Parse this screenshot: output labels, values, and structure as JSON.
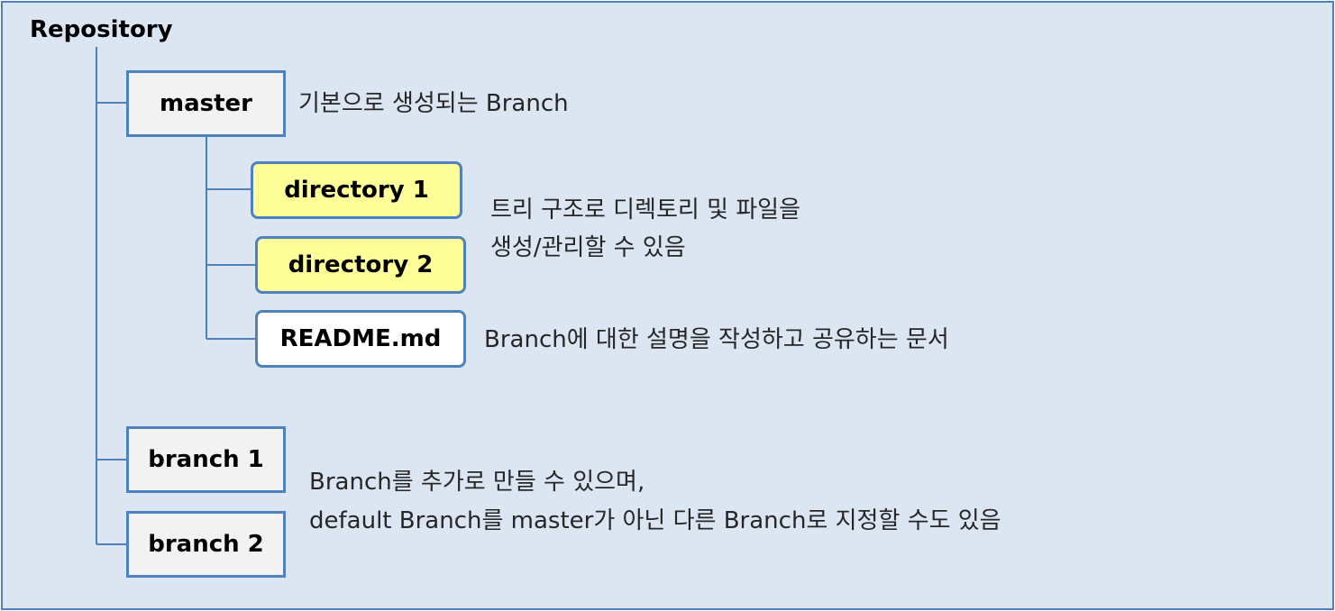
{
  "repository": {
    "label": "Repository"
  },
  "nodes": {
    "master": "master",
    "directory1": "directory 1",
    "directory2": "directory 2",
    "readme": "README.md",
    "branch1": "branch 1",
    "branch2": "branch 2"
  },
  "notes": {
    "master": "기본으로 생성되는 Branch",
    "tree_line1": "트리 구조로 디렉토리 및 파일을",
    "tree_line2": "생성/관리할 수 있음",
    "readme": "Branch에 대한 설명을 작성하고 공유하는 문서",
    "branches_line1": "Branch를 추가로 만들 수 있으며,",
    "branches_line2": "default Branch를 master가 아닌 다른 Branch로 지정할 수도 있음"
  },
  "colors": {
    "background": "#dce6f2",
    "border": "#4f81bd",
    "box_fill": "#f2f2f2",
    "highlight_fill": "#ffff99"
  }
}
